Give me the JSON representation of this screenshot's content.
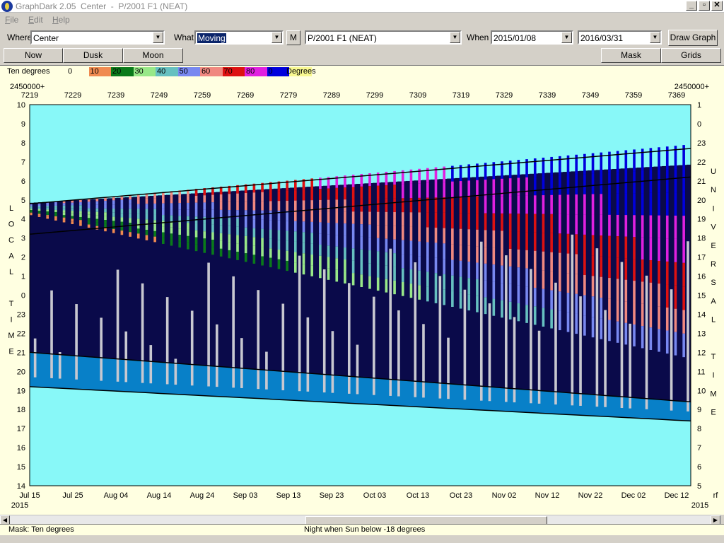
{
  "window": {
    "title": "GraphDark 2.05  Center  -  P/2001 F1 (NEAT)"
  },
  "menu": {
    "items": [
      "File",
      "Edit",
      "Help"
    ]
  },
  "toolbar": {
    "where_label": "Where",
    "where_value": "Center",
    "what_label": "What",
    "what_value": "Moving",
    "m_button": "M",
    "object_value": "P/2001 F1 (NEAT)",
    "when_label": "When",
    "start_date": "2015/01/08",
    "end_date": "2016/03/31",
    "draw_button": "Draw Graph"
  },
  "row2": {
    "now_button": "Now",
    "dusk_button": "Dusk",
    "moon_button": "Moon",
    "mask_button": "Mask",
    "grids_button": "Grids"
  },
  "legend": {
    "label": "Ten degrees",
    "unit": "Degrees",
    "entries": [
      {
        "text": "0",
        "color": "#ffffe1"
      },
      {
        "text": "10",
        "color": "#f08a50"
      },
      {
        "text": "20",
        "color": "#0a7a1a"
      },
      {
        "text": "30",
        "color": "#98e888"
      },
      {
        "text": "40",
        "color": "#66c0c0"
      },
      {
        "text": "50",
        "color": "#7888f0"
      },
      {
        "text": "60",
        "color": "#f08880"
      },
      {
        "text": "70",
        "color": "#dd1111"
      },
      {
        "text": "80",
        "color": "#e020e0"
      },
      {
        "text": "0",
        "color": "#0000dd"
      },
      {
        "text": "",
        "color": "#f8f890"
      }
    ]
  },
  "chart_data": {
    "type": "heatmap",
    "jd_prefix": "2450000+",
    "top_ticks": [
      "7219",
      "7229",
      "7239",
      "7249",
      "7259",
      "7269",
      "7279",
      "7289",
      "7299",
      "7309",
      "7319",
      "7329",
      "7339",
      "7349",
      "7359",
      "7369"
    ],
    "bottom_ticks": [
      "Jul 15",
      "Jul 25",
      "Aug 04",
      "Aug 14",
      "Aug 24",
      "Sep 03",
      "Sep 13",
      "Sep 23",
      "Oct 03",
      "Oct 13",
      "Oct 23",
      "Nov 02",
      "Nov 12",
      "Nov 22",
      "Dec 02",
      "Dec 12"
    ],
    "year_left": "2015",
    "year_right": "2015",
    "right_corner": "rf",
    "left_axis_label": [
      "L",
      "O",
      "C",
      "A",
      "L",
      "",
      "T",
      "I",
      "M",
      "E"
    ],
    "right_axis_label": [
      "U",
      "N",
      "I",
      "V",
      "E",
      "R",
      "S",
      "A",
      "L",
      "",
      "T",
      "I",
      "M",
      "E"
    ],
    "left_ticks": [
      "10",
      "9",
      "8",
      "7",
      "6",
      "5",
      "4",
      "3",
      "2",
      "1",
      "0",
      "23",
      "22",
      "21",
      "20",
      "19",
      "18",
      "17",
      "16",
      "15",
      "14"
    ],
    "right_ticks": [
      "1",
      "0",
      "23",
      "22",
      "21",
      "20",
      "19",
      "18",
      "17",
      "16",
      "15",
      "14",
      "13",
      "12",
      "11",
      "10",
      "9",
      "8",
      "7",
      "6",
      "5"
    ],
    "colors": {
      "day": "#88f8f8",
      "twilight": "#0880c8",
      "night": "#0a0a4a",
      "moon": "#c8c8d0"
    }
  },
  "status": {
    "mask_text": "Mask:  Ten degrees",
    "night_text": "Night when Sun below -18 degrees"
  }
}
